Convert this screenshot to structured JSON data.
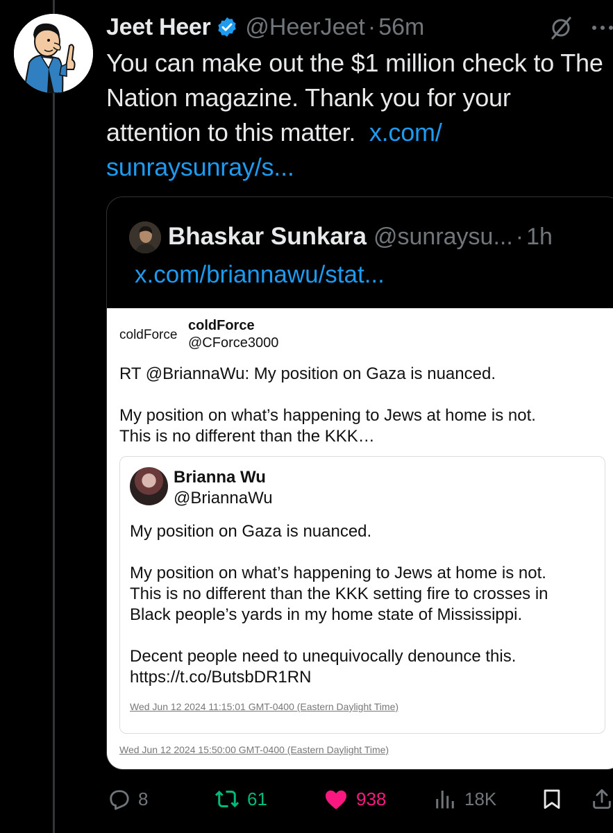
{
  "author": {
    "display_name": "Jeet Heer",
    "handle": "@HeerJeet",
    "separator": "·",
    "time": "56m"
  },
  "tweet": {
    "text": "You can make out the $1 million check to The Nation magazine. Thank you for your attention to this matter.",
    "link": "x.com/ sunraysunray/s..."
  },
  "quote": {
    "display_name": "Bhaskar Sunkara",
    "handle": "@sunraysu...",
    "separator": "·",
    "time": "1h",
    "link": "x.com/briannawu/stat..."
  },
  "screenshot": {
    "cf_avatar_alt": "coldForce",
    "cf_name": "coldForce",
    "cf_handle": "@CForce3000",
    "cf_text": "RT @BriannaWu: My position on Gaza is nuanced.\n\nMy position on what’s happening to Jews at home is not.\nThis is no different than the KKK…",
    "bw_name": "Brianna Wu",
    "bw_handle": "@BriannaWu",
    "bw_text": "My position on Gaza is nuanced.\n\nMy position on what’s happening to Jews at home is not.\nThis is no different than the KKK setting fire to crosses in\nBlack people’s yards in my home state of Mississippi.\n\nDecent people need to unequivocally denounce this.\nhttps://t.co/ButsbDR1RN",
    "bw_date": "Wed Jun 12 2024 11:15:01 GMT-0400 (Eastern Daylight Time)",
    "cf_date": "Wed Jun 12 2024 15:50:00 GMT-0400 (Eastern Daylight Time)"
  },
  "actions": {
    "replies": "8",
    "retweets": "61",
    "likes": "938",
    "views": "18K"
  },
  "icons": {
    "verified": "verified-badge-icon",
    "grok": "grok-icon",
    "more": "more-icon",
    "reply": "reply-icon",
    "retweet": "retweet-icon",
    "like": "heart-icon",
    "views": "views-icon",
    "bookmark": "bookmark-icon",
    "share": "share-icon"
  },
  "colors": {
    "background": "#000000",
    "text": "#e7e9ea",
    "secondary": "#71767b",
    "link": "#1d9bf0",
    "retweet": "#00ba7c",
    "like": "#f91880"
  }
}
